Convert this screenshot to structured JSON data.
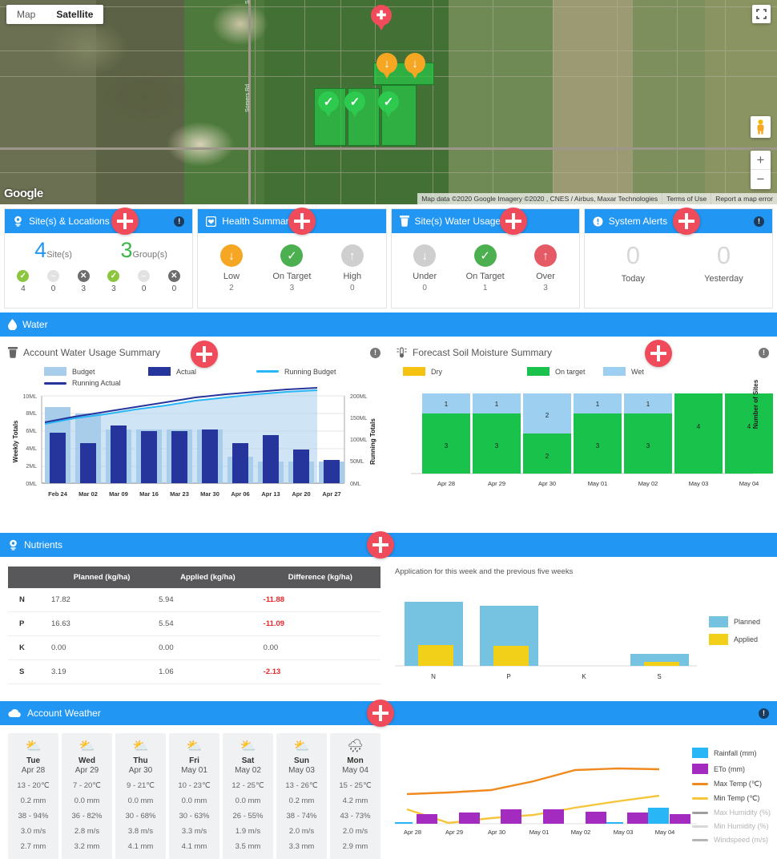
{
  "map": {
    "type_buttons": [
      {
        "label": "Map",
        "selected": false
      },
      {
        "label": "Satellite",
        "selected": true
      }
    ],
    "logo": "Google",
    "attribution": [
      "Map data ©2020 Google Imagery ©2020 , CNES / Airbus, Maxar Technologies",
      "Terms of Use",
      "Report a map error"
    ],
    "street_labels": [
      "Somers Rd",
      "Somers Rd"
    ],
    "zoom_in": "+",
    "zoom_out": "−",
    "markers": [
      {
        "status": "alert",
        "glyph": "✚"
      },
      {
        "status": "low",
        "glyph": "↓"
      },
      {
        "status": "low",
        "glyph": "↓"
      },
      {
        "status": "ok",
        "glyph": "✓"
      },
      {
        "status": "ok",
        "glyph": "✓"
      },
      {
        "status": "ok",
        "glyph": "✓"
      }
    ]
  },
  "summary_cards": [
    {
      "title": "Site(s) & Locations",
      "icon": "location-pin-icon",
      "has_info": true,
      "bignums": [
        {
          "value": "4",
          "label": "Site(s)",
          "color": "#2196f3"
        },
        {
          "value": "3",
          "label": "Group(s)",
          "color": "#3cb54a"
        }
      ],
      "stats": [
        {
          "state": "ok",
          "value": "4"
        },
        {
          "state": "muted",
          "value": "0"
        },
        {
          "state": "off",
          "value": "3"
        },
        {
          "state": "ok",
          "value": "3"
        },
        {
          "state": "muted",
          "value": "0"
        },
        {
          "state": "off",
          "value": "0"
        }
      ]
    },
    {
      "title": "Health Summary",
      "icon": "heart-icon",
      "has_info": false,
      "items": [
        {
          "label": "Low",
          "value": "2",
          "color": "#f5a623",
          "glyph": "↓"
        },
        {
          "label": "On Target",
          "value": "3",
          "color": "#4caf50",
          "glyph": "✓"
        },
        {
          "label": "High",
          "value": "0",
          "color": "#cfcfcf",
          "glyph": "↑"
        }
      ]
    },
    {
      "title": "Site(s) Water Usage",
      "icon": "water-tank-icon",
      "has_info": false,
      "items": [
        {
          "label": "Under",
          "value": "0",
          "color": "#cfcfcf",
          "glyph": "↓"
        },
        {
          "label": "On Target",
          "value": "1",
          "color": "#4caf50",
          "glyph": "✓"
        },
        {
          "label": "Over",
          "value": "3",
          "color": "#e55a65",
          "glyph": "↑"
        }
      ]
    },
    {
      "title": "System Alerts",
      "icon": "alert-icon",
      "has_info": true,
      "alerts": [
        {
          "label": "Today",
          "value": "0"
        },
        {
          "label": "Yesterday",
          "value": "0"
        }
      ]
    }
  ],
  "water_section": {
    "title": "Water",
    "icon": "water-drop-icon",
    "left": {
      "title": "Account Water Usage Summary",
      "icon": "water-tank-icon",
      "has_info": true
    },
    "right": {
      "title": "Forecast Soil Moisture Summary",
      "icon": "soil-moisture-icon",
      "has_info": true
    }
  },
  "nutrients_section": {
    "title": "Nutrients",
    "icon": "location-pin-icon",
    "table": {
      "columns": [
        "",
        "Planned (kg/ha)",
        "Applied (kg/ha)",
        "Difference (kg/ha)"
      ],
      "rows": [
        {
          "symbol": "N",
          "planned": "17.82",
          "applied": "5.94",
          "difference": "-11.88",
          "negative": true
        },
        {
          "symbol": "P",
          "planned": "16.63",
          "applied": "5.54",
          "difference": "-11.09",
          "negative": true
        },
        {
          "symbol": "K",
          "planned": "0.00",
          "applied": "0.00",
          "difference": "0.00",
          "negative": false
        },
        {
          "symbol": "S",
          "planned": "3.19",
          "applied": "1.06",
          "difference": "-2.13",
          "negative": true
        }
      ]
    },
    "chart_caption": "Application for this week and the previous five weeks"
  },
  "weather_section": {
    "title": "Account Weather",
    "icon": "cloud-icon",
    "has_info": true,
    "days": [
      {
        "icon": "partly-cloudy-icon",
        "day": "Tue",
        "date": "Apr 28",
        "temp": "13 - 20℃",
        "rain": "0.2 mm",
        "humidity": "38 - 94%",
        "wind": "3.0 m/s",
        "eto": "2.7 mm"
      },
      {
        "icon": "partly-cloudy-icon",
        "day": "Wed",
        "date": "Apr 29",
        "temp": "7 - 20℃",
        "rain": "0.0 mm",
        "humidity": "36 - 82%",
        "wind": "2.8 m/s",
        "eto": "3.2 mm"
      },
      {
        "icon": "partly-cloudy-icon",
        "day": "Thu",
        "date": "Apr 30",
        "temp": "9 - 21℃",
        "rain": "0.0 mm",
        "humidity": "30 - 68%",
        "wind": "3.8 m/s",
        "eto": "4.1 mm"
      },
      {
        "icon": "partly-cloudy-icon",
        "day": "Fri",
        "date": "May 01",
        "temp": "10 - 23℃",
        "rain": "0.0 mm",
        "humidity": "30 - 63%",
        "wind": "3.3 m/s",
        "eto": "4.1 mm"
      },
      {
        "icon": "partly-cloudy-icon",
        "day": "Sat",
        "date": "May 02",
        "temp": "12 - 25℃",
        "rain": "0.0 mm",
        "humidity": "26 - 55%",
        "wind": "1.9 m/s",
        "eto": "3.5 mm"
      },
      {
        "icon": "partly-cloudy-icon",
        "day": "Sun",
        "date": "May 03",
        "temp": "13 - 26℃",
        "rain": "0.2 mm",
        "humidity": "38 - 74%",
        "wind": "2.0 m/s",
        "eto": "3.3 mm"
      },
      {
        "icon": "rain-icon",
        "day": "Mon",
        "date": "May 04",
        "temp": "15 - 25℃",
        "rain": "4.2 mm",
        "humidity": "43 - 73%",
        "wind": "2.0 m/s",
        "eto": "2.9 mm"
      }
    ]
  },
  "chart_data": [
    {
      "id": "account-water-usage",
      "type": "bar",
      "title": "Account Water Usage Summary",
      "categories": [
        "Feb 24",
        "Mar 02",
        "Mar 09",
        "Mar 16",
        "Mar 23",
        "Mar 30",
        "Apr 06",
        "Apr 13",
        "Apr 20",
        "Apr 27"
      ],
      "series": [
        {
          "name": "Budget",
          "color": "#a8cdeb",
          "axis": "left",
          "values": [
            8.65,
            8.0,
            6.15,
            6.15,
            6.15,
            6.15,
            3.0,
            2.5,
            2.5,
            2.5
          ]
        },
        {
          "name": "Actual",
          "color": "#26359c",
          "axis": "left",
          "values": [
            5.75,
            4.55,
            6.6,
            5.95,
            5.95,
            6.1,
            4.6,
            5.45,
            3.85,
            2.65
          ]
        },
        {
          "name": "Running Budget",
          "color": "#29b6f6",
          "axis": "right",
          "values": [
            136,
            143,
            148,
            154,
            159,
            165,
            169,
            173,
            177,
            180
          ]
        },
        {
          "name": "Running Actual",
          "color": "#26359c",
          "axis": "right",
          "values": [
            138,
            145,
            150,
            156,
            162,
            168,
            172,
            177,
            181,
            185
          ]
        }
      ],
      "xlabel": "",
      "ylabel": "Weekly Totals",
      "ylabel_right": "Running Totals",
      "ylim": [
        0,
        10
      ],
      "yticks": [
        "0ML",
        "2ML",
        "4ML",
        "6ML",
        "8ML",
        "10ML"
      ],
      "ylim_right": [
        0,
        200
      ],
      "yticks_right": [
        "0ML",
        "50ML",
        "100ML",
        "150ML",
        "200ML"
      ],
      "grid": true,
      "legend_position": "top"
    },
    {
      "id": "forecast-soil-moisture",
      "type": "bar",
      "title": "Forecast Soil Moisture Summary",
      "stacked": true,
      "categories": [
        "Apr 28",
        "Apr 29",
        "Apr 30",
        "May 01",
        "May 02",
        "May 03",
        "May 04"
      ],
      "series": [
        {
          "name": "Dry",
          "color": "#f5c211",
          "values": [
            0,
            0,
            0,
            0,
            0,
            0,
            0
          ]
        },
        {
          "name": "On target",
          "color": "#19c24a",
          "values": [
            3,
            3,
            2,
            3,
            3,
            4,
            4
          ]
        },
        {
          "name": "Wet",
          "color": "#9ccff0",
          "values": [
            1,
            1,
            2,
            1,
            1,
            0,
            0
          ]
        }
      ],
      "xlabel": "",
      "ylabel_right": "Number of Sites",
      "ylim": [
        0,
        4
      ],
      "grid": false,
      "legend_position": "top"
    },
    {
      "id": "nutrient-application",
      "type": "bar",
      "title": "Application for this week and the previous five weeks",
      "categories": [
        "N",
        "P",
        "K",
        "S"
      ],
      "series": [
        {
          "name": "Planned",
          "color": "#75c3e0",
          "values": [
            17.82,
            16.63,
            0.0,
            3.19
          ]
        },
        {
          "name": "Applied",
          "color": "#f2cf18",
          "values": [
            5.94,
            5.54,
            0.0,
            1.06
          ]
        }
      ],
      "overlaid": true,
      "ylim": [
        0,
        18
      ],
      "grid": false,
      "legend_position": "right"
    },
    {
      "id": "account-weather",
      "type": "line",
      "title": "Account Weather",
      "categories": [
        "Apr 28",
        "Apr 29",
        "Apr 30",
        "May 01",
        "May 02",
        "May 03",
        "May 04"
      ],
      "series": [
        {
          "name": "Rainfall (mm)",
          "color": "#29b6f6",
          "kind": "bar",
          "values": [
            0.2,
            0.0,
            0.0,
            0.0,
            0.0,
            0.2,
            4.2
          ]
        },
        {
          "name": "ETo (mm)",
          "color": "#a32bbf",
          "kind": "bar",
          "values": [
            2.7,
            3.2,
            4.1,
            4.1,
            3.5,
            3.3,
            2.9
          ]
        },
        {
          "name": "Max Temp (℃)",
          "color": "#f08a1e",
          "kind": "line",
          "values": [
            20,
            20,
            21,
            23,
            25,
            26,
            25
          ]
        },
        {
          "name": "Min Temp (℃)",
          "color": "#f5c63c",
          "kind": "line",
          "values": [
            13,
            7,
            9,
            10,
            12,
            13,
            15
          ]
        },
        {
          "name": "Max Humidity (%)",
          "color": "#9e9e9e",
          "kind": "line",
          "hidden": true,
          "values": [
            94,
            82,
            68,
            63,
            55,
            74,
            73
          ]
        },
        {
          "name": "Min Humidity (%)",
          "color": "#d0d0d0",
          "kind": "line",
          "hidden": true,
          "values": [
            38,
            36,
            30,
            30,
            26,
            38,
            43
          ]
        },
        {
          "name": "Windspeed (m/s)",
          "color": "#b5b5b5",
          "kind": "line",
          "hidden": true,
          "values": [
            3.0,
            2.8,
            3.8,
            3.3,
            1.9,
            2.0,
            2.0
          ]
        }
      ],
      "grid": false,
      "legend_position": "right"
    }
  ]
}
